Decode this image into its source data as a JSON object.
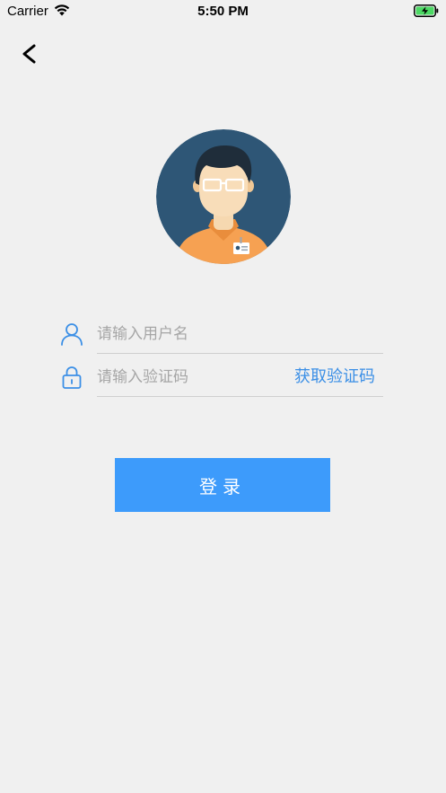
{
  "status_bar": {
    "carrier": "Carrier",
    "time": "5:50 PM",
    "wifi_icon": "wifi-icon",
    "battery_icon": "battery-charging-icon"
  },
  "nav": {
    "back_icon": "chevron-left-icon"
  },
  "avatar": {
    "icon": "user-avatar-illustration"
  },
  "form": {
    "username": {
      "icon": "user-icon",
      "placeholder": "请输入用户名",
      "value": ""
    },
    "code": {
      "icon": "lock-icon",
      "placeholder": "请输入验证码",
      "value": "",
      "get_code_label": "获取验证码"
    },
    "login_label": "登录"
  },
  "colors": {
    "accent": "#3d9bfb",
    "link": "#3b8fe6",
    "background": "#f0f0f0"
  }
}
